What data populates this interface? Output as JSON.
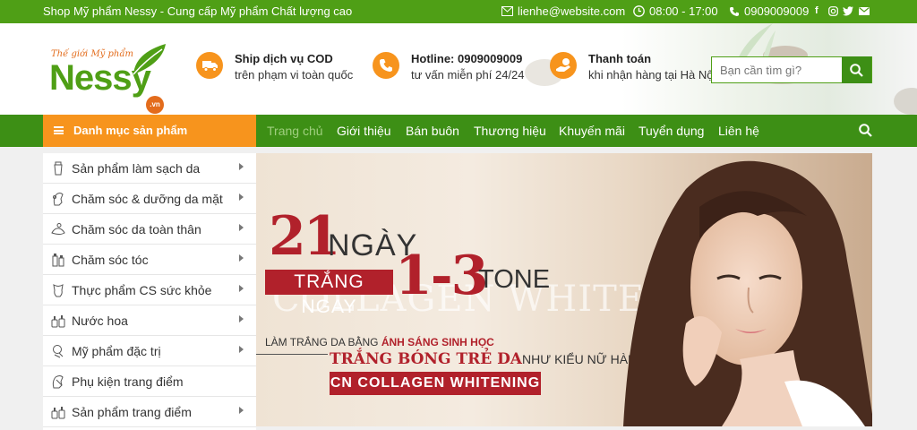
{
  "topbar": {
    "tagline": "Shop Mỹ phẩm Nessy - Cung cấp Mỹ phẩm Chất lượng cao",
    "email": "lienhe@website.com",
    "hours": "08:00 - 17:00",
    "phone": "0909009009",
    "social": [
      "facebook-icon",
      "instagram-icon",
      "twitter-icon",
      "mail-icon"
    ]
  },
  "logo": {
    "small": "Thế giới Mỹ phẩm",
    "name": "Nessy",
    "suffix": ".vn"
  },
  "features": [
    {
      "title": "Ship dịch vụ COD",
      "subtitle": "trên phạm vi toàn quốc",
      "icon": "truck-icon"
    },
    {
      "title": "Hotline: 0909009009",
      "subtitle": "tư vấn miễn phí 24/24",
      "icon": "phone-icon"
    },
    {
      "title": "Thanh toán",
      "subtitle": "khi nhận hàng tại Hà Nội",
      "icon": "hand-money-icon"
    }
  ],
  "search": {
    "placeholder": "Bạn cần tìm gì?"
  },
  "nav": {
    "category_label": "Danh mục sản phẩm",
    "items": [
      "Trang chủ",
      "Giới thiệu",
      "Bán buôn",
      "Thương hiệu",
      "Khuyến mãi",
      "Tuyển dụng",
      "Liên hệ"
    ],
    "active": "Trang chủ"
  },
  "sidebar": {
    "items": [
      {
        "label": "Sản phẩm làm sạch da",
        "icon": "cleanser-tube-icon",
        "has_sub": true
      },
      {
        "label": "Chăm sóc & dưỡng da mặt",
        "icon": "face-care-icon",
        "has_sub": true
      },
      {
        "label": "Chăm sóc da toàn thân",
        "icon": "body-care-icon",
        "has_sub": true
      },
      {
        "label": "Chăm sóc tóc",
        "icon": "hair-care-icon",
        "has_sub": true
      },
      {
        "label": "Thực phẩm CS sức khỏe",
        "icon": "supplement-icon",
        "has_sub": true
      },
      {
        "label": "Nước hoa",
        "icon": "perfume-icon",
        "has_sub": true
      },
      {
        "label": "Mỹ phẩm đặc trị",
        "icon": "treatment-icon",
        "has_sub": true
      },
      {
        "label": "Phụ kiện trang điểm",
        "icon": "accessory-icon",
        "has_sub": false
      },
      {
        "label": "Sản phẩm trang điểm",
        "icon": "makeup-icon",
        "has_sub": true
      }
    ]
  },
  "banner": {
    "big_number": "21",
    "ngay": "NGÀY",
    "trang_ngay": "TRẮNG NGAY",
    "range": "1-3",
    "tone": "TONE",
    "ghost": "COLLAGEN WHITENING",
    "line1_prefix": "LÀM TRẮNG DA BẰNG",
    "line1_highlight": "ÁNH SÁNG SINH HỌC",
    "line2_highlight": "TRẮNG BÓNG TRẺ DA",
    "line2_rest": "NHƯ KIỂU NỮ HÀN",
    "cta": "CN COLLAGEN WHITENING"
  },
  "colors": {
    "green": "#4f9f16",
    "dark_green": "#3d8f15",
    "orange": "#f7941d",
    "red": "#b1212b"
  }
}
